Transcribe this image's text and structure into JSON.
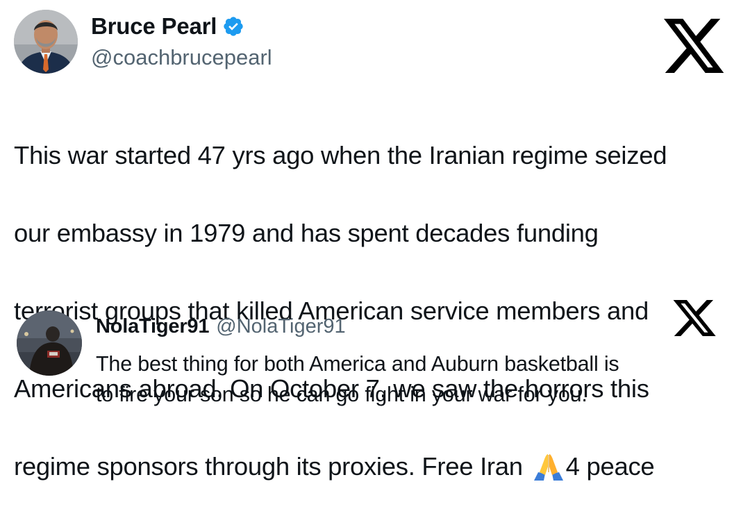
{
  "main_tweet": {
    "author_name": "Bruce Pearl",
    "handle": "@coachbrucepearl",
    "verified": true,
    "text_lines": [
      "This war started 47 yrs ago when the Iranian regime seized",
      "our embassy in 1979 and has spent decades funding",
      "terrorist groups that killed American service members and",
      "Americans abroad. On October 7, we saw the horrors this"
    ],
    "last_line_before_emoji": "regime sponsors through its proxies. Free Iran",
    "emoji": "folded-hands-icon",
    "last_line_after_emoji": "4 peace",
    "platform_logo": "x-logo-icon"
  },
  "reply_tweet": {
    "author_name": "NolaTiger91",
    "handle": "@NolaTiger91",
    "text_lines": [
      "The best thing for both America and Auburn basketball is",
      "to fire your son so he can go fight in your war for you."
    ],
    "platform_logo": "x-logo-icon"
  },
  "colors": {
    "text_primary": "#0f1419",
    "text_secondary": "#536471",
    "verified_blue": "#1d9bf0",
    "background": "#ffffff"
  }
}
